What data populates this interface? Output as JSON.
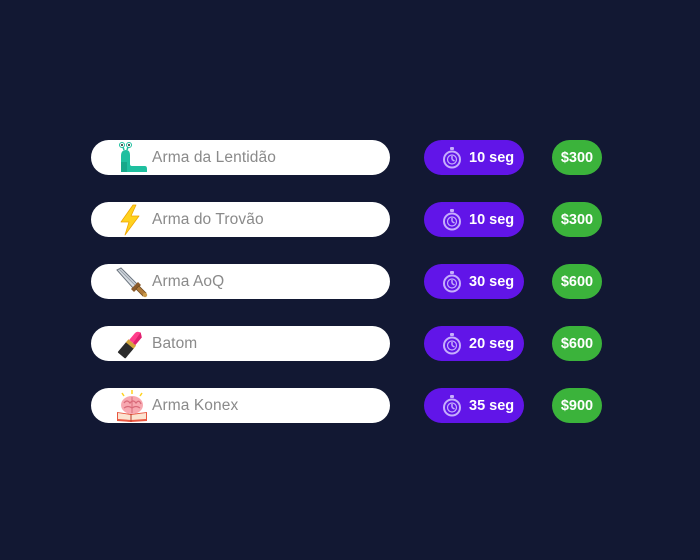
{
  "items": [
    {
      "name": "Arma da Lentidão",
      "icon": "slug-icon",
      "time": "10 seg",
      "price": "$300"
    },
    {
      "name": "Arma do Trovão",
      "icon": "lightning-icon",
      "time": "10 seg",
      "price": "$300"
    },
    {
      "name": "Arma AoQ",
      "icon": "sword-icon",
      "time": "30 seg",
      "price": "$600"
    },
    {
      "name": "Batom",
      "icon": "lipstick-icon",
      "time": "20 seg",
      "price": "$600"
    },
    {
      "name": "Arma Konex",
      "icon": "brain-book-icon",
      "time": "35 seg",
      "price": "$900"
    }
  ],
  "colors": {
    "background": "#121833",
    "item_pill": "#ffffff",
    "item_text": "#8a8a8a",
    "time_pill": "#6115e8",
    "price_pill": "#3bb33b"
  }
}
